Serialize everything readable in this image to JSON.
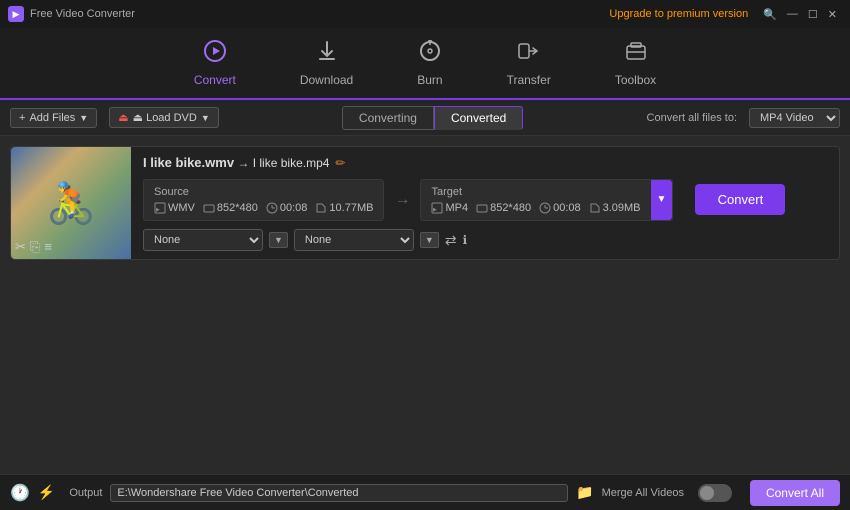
{
  "app": {
    "title": "Free Video Converter",
    "upgrade_text": "Upgrade to premium version"
  },
  "title_bar": {
    "search_icon": "🔍",
    "minimize": "—",
    "restore": "☐",
    "close": "✕"
  },
  "nav": {
    "items": [
      {
        "id": "convert",
        "label": "Convert",
        "icon": "▶",
        "active": true
      },
      {
        "id": "download",
        "label": "Download",
        "icon": "⬇"
      },
      {
        "id": "burn",
        "label": "Burn",
        "icon": "⊙"
      },
      {
        "id": "transfer",
        "label": "Transfer",
        "icon": "⇌"
      },
      {
        "id": "toolbox",
        "label": "Toolbox",
        "icon": "⊞"
      }
    ]
  },
  "toolbar": {
    "add_files_label": "+ Add Files",
    "load_dvd_label": "⏏ Load DVD"
  },
  "tabs": {
    "converting_label": "Converting",
    "converted_label": "Converted",
    "active": "converted"
  },
  "convert_all": {
    "label": "Convert all files to:",
    "format": "MP4 Video"
  },
  "file": {
    "name": "I like bike.wmv",
    "target_name": "I like bike.mp4",
    "source": {
      "title": "Source",
      "format": "WMV",
      "resolution": "852*480",
      "duration": "00:08",
      "size": "10.77MB"
    },
    "target": {
      "title": "Target",
      "format": "MP4",
      "resolution": "852*480",
      "duration": "00:08",
      "size": "3.09MB"
    },
    "effect1": "None",
    "effect2": "None"
  },
  "buttons": {
    "convert": "Convert",
    "convert_all": "Convert All"
  },
  "footer": {
    "output_label": "Output",
    "output_path": "E:\\Wondershare Free Video Converter\\Converted",
    "merge_label": "Merge All Videos"
  }
}
